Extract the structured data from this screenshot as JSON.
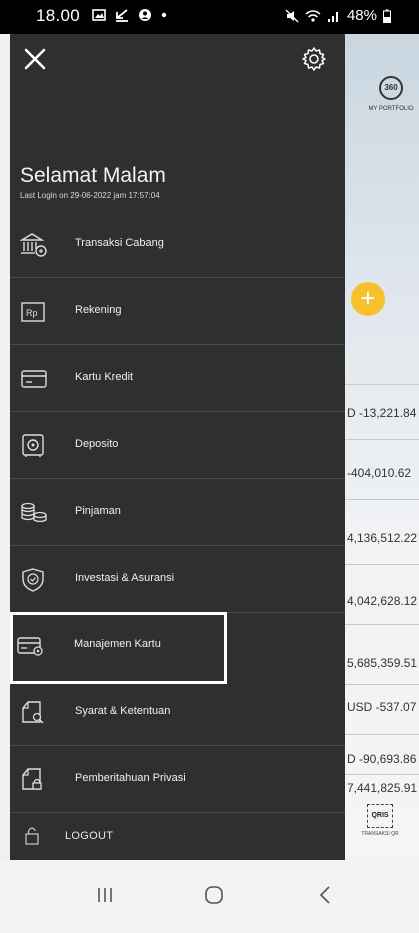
{
  "status": {
    "time": "18.00",
    "battery": "48%"
  },
  "drawer": {
    "greeting": "Selamat Malam",
    "last_login": "Last Login on 29-06-2022 jam 17:57:04",
    "items": [
      {
        "label": "Transaksi Cabang",
        "icon": "bank-branch-icon"
      },
      {
        "label": "Rekening",
        "icon": "rupiah-card-icon"
      },
      {
        "label": "Kartu Kredit",
        "icon": "credit-card-icon"
      },
      {
        "label": "Deposito",
        "icon": "safe-icon"
      },
      {
        "label": "Pinjaman",
        "icon": "coins-icon"
      },
      {
        "label": "Investasi & Asuransi",
        "icon": "shield-icon"
      },
      {
        "label": "Manajemen Kartu",
        "icon": "card-settings-icon"
      },
      {
        "label": "Syarat & Ketentuan",
        "icon": "document-search-icon"
      },
      {
        "label": "Pemberitahuan Privasi",
        "icon": "document-lock-icon"
      }
    ],
    "logout": "LOGOUT"
  },
  "background": {
    "portfolio_badge": "360",
    "portfolio_label": "MY PORTFOLIO",
    "amounts": [
      "D -13,221.84",
      "-404,010.62",
      "4,136,512.22",
      "4,042,628.12",
      "5,685,359.51",
      "USD -537.07",
      "D -90,693.86",
      "7,441,825.91"
    ],
    "qris_badge": "QRIS",
    "qris_label": "TRANSAKSI QR"
  },
  "colors": {
    "drawer_bg": "#2f2f2f",
    "fab": "#f6c12a"
  }
}
